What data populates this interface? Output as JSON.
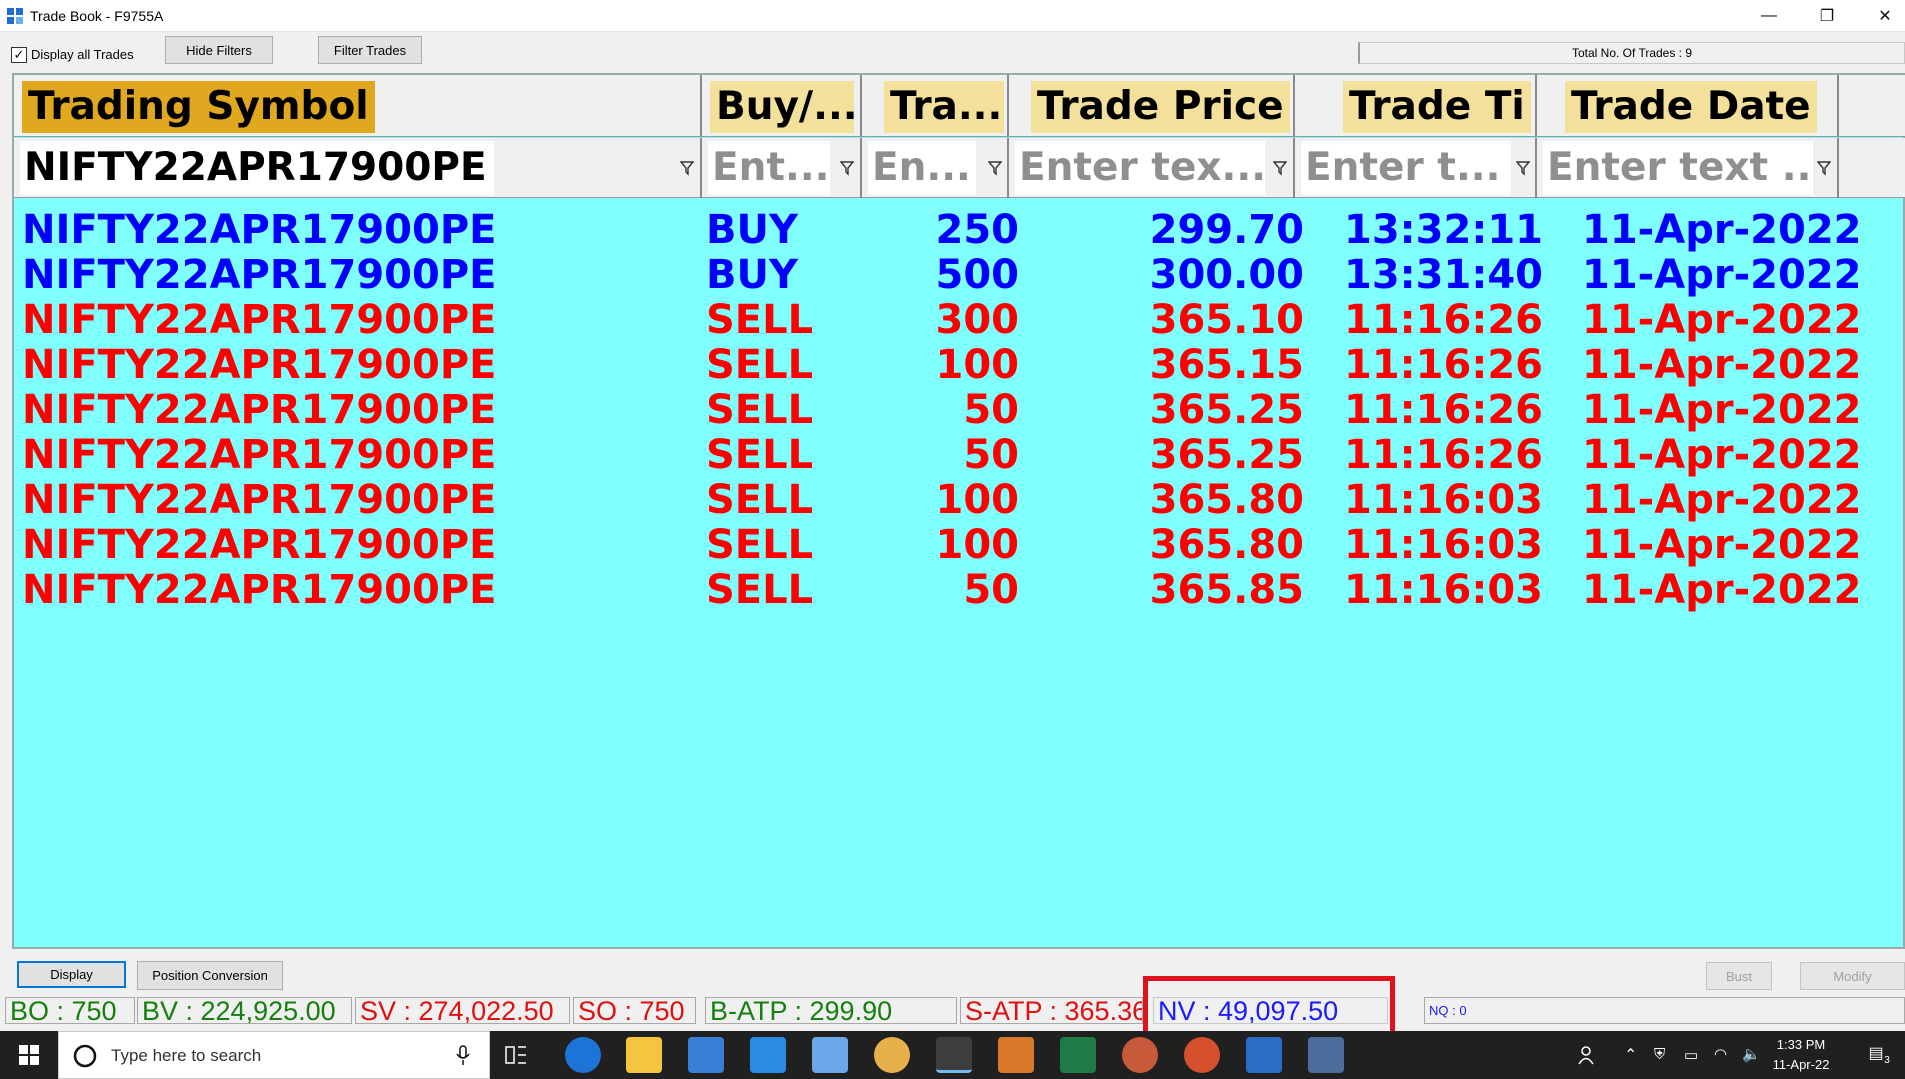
{
  "window": {
    "title": "Trade Book - F9755A",
    "minimize": "—",
    "restore": "❐",
    "close": "✕"
  },
  "toolbar": {
    "display_all_label": "Display all Trades",
    "display_all_checked": "✓",
    "hide_filters": "Hide Filters",
    "filter_trades": "Filter Trades",
    "total_trades": "Total No. Of Trades : 9"
  },
  "columns": {
    "symbol": "Trading Symbol",
    "side": "Buy/...",
    "qty": "Tra...",
    "price": "Trade Price",
    "time": "Trade Ti",
    "date": "Trade Date"
  },
  "filters": {
    "symbol": "NIFTY22APR17900PE",
    "side": "Ent...",
    "qty": "En...",
    "price": "Enter tex...",
    "time": "Enter t...",
    "date": "Enter text ..."
  },
  "colors": {
    "buy": "#0000ff",
    "sell": "#ff0000",
    "grid_bg": "#80ffff",
    "header_bg": "#e8b830"
  },
  "trades": [
    {
      "symbol": "NIFTY22APR17900PE",
      "side": "BUY",
      "qty": "250",
      "price": "299.70",
      "time": "13:32:11",
      "date": "11-Apr-2022"
    },
    {
      "symbol": "NIFTY22APR17900PE",
      "side": "BUY",
      "qty": "500",
      "price": "300.00",
      "time": "13:31:40",
      "date": "11-Apr-2022"
    },
    {
      "symbol": "NIFTY22APR17900PE",
      "side": "SELL",
      "qty": "300",
      "price": "365.10",
      "time": "11:16:26",
      "date": "11-Apr-2022"
    },
    {
      "symbol": "NIFTY22APR17900PE",
      "side": "SELL",
      "qty": "100",
      "price": "365.15",
      "time": "11:16:26",
      "date": "11-Apr-2022"
    },
    {
      "symbol": "NIFTY22APR17900PE",
      "side": "SELL",
      "qty": "50",
      "price": "365.25",
      "time": "11:16:26",
      "date": "11-Apr-2022"
    },
    {
      "symbol": "NIFTY22APR17900PE",
      "side": "SELL",
      "qty": "50",
      "price": "365.25",
      "time": "11:16:26",
      "date": "11-Apr-2022"
    },
    {
      "symbol": "NIFTY22APR17900PE",
      "side": "SELL",
      "qty": "100",
      "price": "365.80",
      "time": "11:16:03",
      "date": "11-Apr-2022"
    },
    {
      "symbol": "NIFTY22APR17900PE",
      "side": "SELL",
      "qty": "100",
      "price": "365.80",
      "time": "11:16:03",
      "date": "11-Apr-2022"
    },
    {
      "symbol": "NIFTY22APR17900PE",
      "side": "SELL",
      "qty": "50",
      "price": "365.85",
      "time": "11:16:03",
      "date": "11-Apr-2022"
    }
  ],
  "actions": {
    "display": "Display",
    "position_conversion": "Position Conversion",
    "bust": "Bust",
    "modify": "Modify"
  },
  "status": {
    "bo": "BO : 750",
    "bv": "BV : 224,925.00",
    "sv": "SV : 274,022.50",
    "so": "SO : 750",
    "batp": "B-ATP : 299.90",
    "satp": "S-ATP : 365.36",
    "nv": "NV : 49,097.50",
    "nq": "NQ : 0"
  },
  "taskbar": {
    "search_placeholder": "Type here to search",
    "time": "1:33 PM",
    "date": "11-Apr-22",
    "notification_count": "3"
  }
}
